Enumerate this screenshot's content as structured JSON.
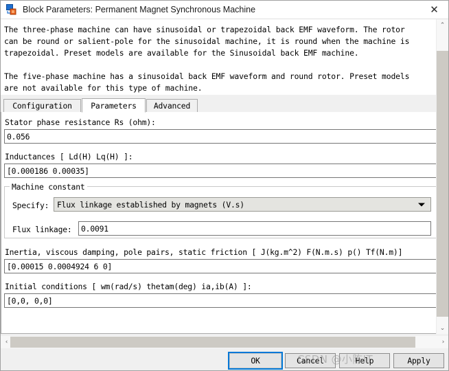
{
  "window": {
    "title": "Block Parameters: Permanent Magnet Synchronous Machine",
    "icon": "simulink-block-icon",
    "close_label": "✕"
  },
  "description": {
    "paragraph1": "The three-phase machine can have sinusoidal or trapezoidal back EMF waveform. The rotor\ncan be round or salient-pole for the sinusoidal machine, it is round when the machine is\ntrapezoidal. Preset models are available for the Sinusoidal back EMF machine.",
    "paragraph2": "The five-phase machine has a sinusoidal back EMF waveform and round rotor. Preset models\nare not available for this type of machine."
  },
  "tabs": [
    {
      "label": "Configuration",
      "selected": false
    },
    {
      "label": "Parameters",
      "selected": true
    },
    {
      "label": "Advanced",
      "selected": false
    }
  ],
  "parameters": {
    "stator_resistance": {
      "label": "Stator phase resistance Rs (ohm):",
      "value": "0.056"
    },
    "inductances": {
      "label": "Inductances [ Ld(H) Lq(H) ]:",
      "value": "[0.000186 0.00035]"
    },
    "machine_constant": {
      "group_title": "Machine constant",
      "specify_label": "Specify:",
      "specify_value": "Flux linkage established by magnets (V.s)",
      "flux_label": "Flux linkage:",
      "flux_value": "0.0091"
    },
    "inertia": {
      "label": "Inertia, viscous damping, pole pairs, static friction [ J(kg.m^2)  F(N.m.s)  p()  Tf(N.m)]",
      "value": "[0.00015 0.0004924 6 0]"
    },
    "initial_conditions": {
      "label": "Initial conditions  [ wm(rad/s)  thetam(deg)  ia,ib(A) ]:",
      "value": "[0,0,  0,0]"
    }
  },
  "buttons": {
    "ok": "OK",
    "cancel": "Cancel",
    "help": "Help",
    "apply": "Apply"
  },
  "scrollbars": {
    "up_arrow": "⌃",
    "down_arrow": "⌄",
    "left_arrow": "‹",
    "right_arrow": "›"
  },
  "watermark": {
    "text": "CSDN @小陈IT"
  },
  "colors": {
    "focus_ring": "#0078d7",
    "window_bg": "#f0f0f0",
    "panel_bg": "#ffffff",
    "scroll_thumb": "#cdcac4"
  }
}
